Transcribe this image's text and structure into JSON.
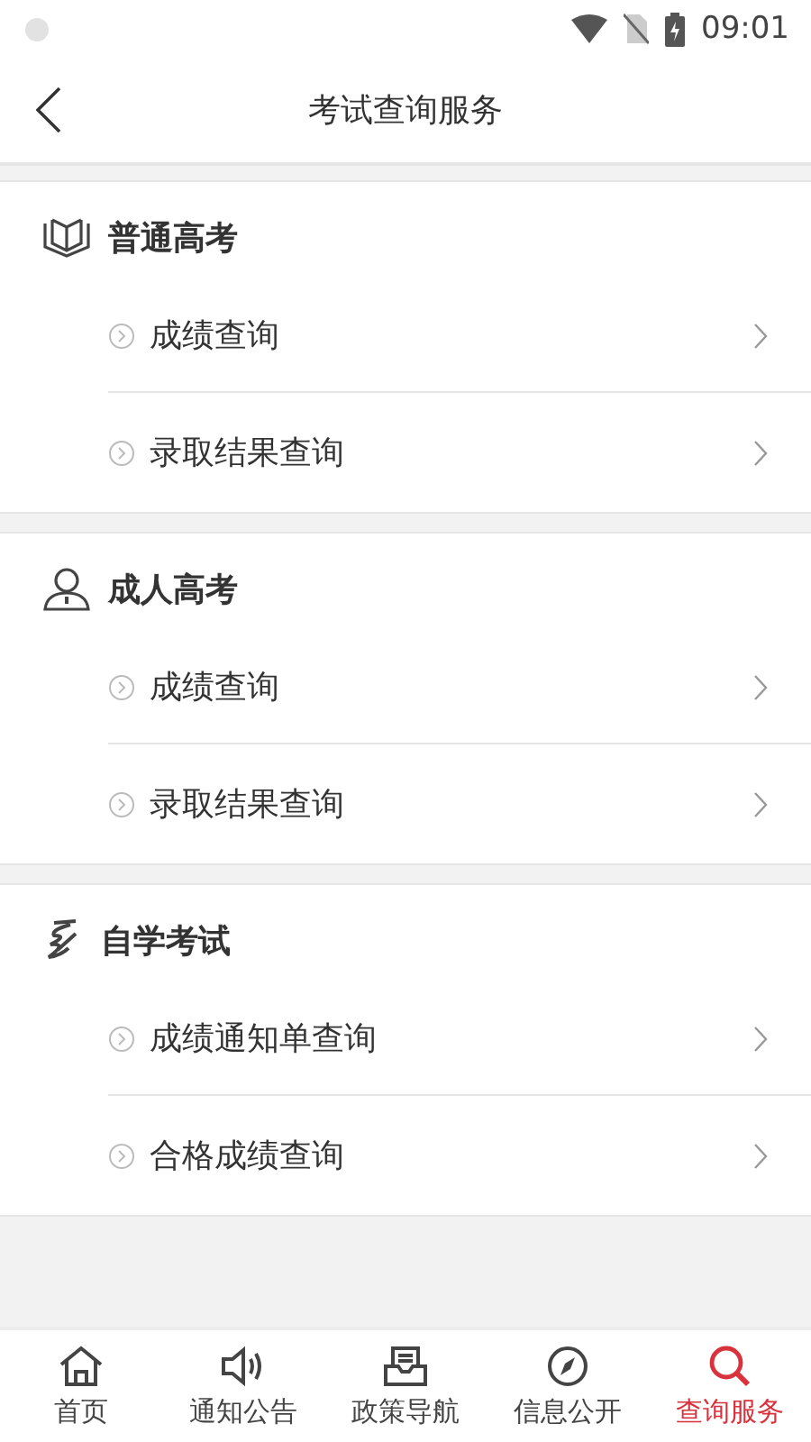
{
  "status_bar": {
    "time": "09:01"
  },
  "header": {
    "title": "考试查询服务"
  },
  "sections": [
    {
      "title": "普通高考",
      "kind": "book",
      "items": [
        "成绩查询",
        "录取结果查询"
      ]
    },
    {
      "title": "成人高考",
      "kind": "person",
      "items": [
        "成绩查询",
        "录取结果查询"
      ]
    },
    {
      "title": "自学考试",
      "kind": "pen",
      "items": [
        "成绩通知单查询",
        "合格成绩查询"
      ]
    }
  ],
  "tab_bar": [
    {
      "label": "首页",
      "kind": "home",
      "selected": false
    },
    {
      "label": "通知公告",
      "kind": "speaker",
      "selected": false
    },
    {
      "label": "政策导航",
      "kind": "inbox",
      "selected": false
    },
    {
      "label": "信息公开",
      "kind": "compass",
      "selected": false
    },
    {
      "label": "查询服务",
      "kind": "search",
      "selected": true
    }
  ]
}
